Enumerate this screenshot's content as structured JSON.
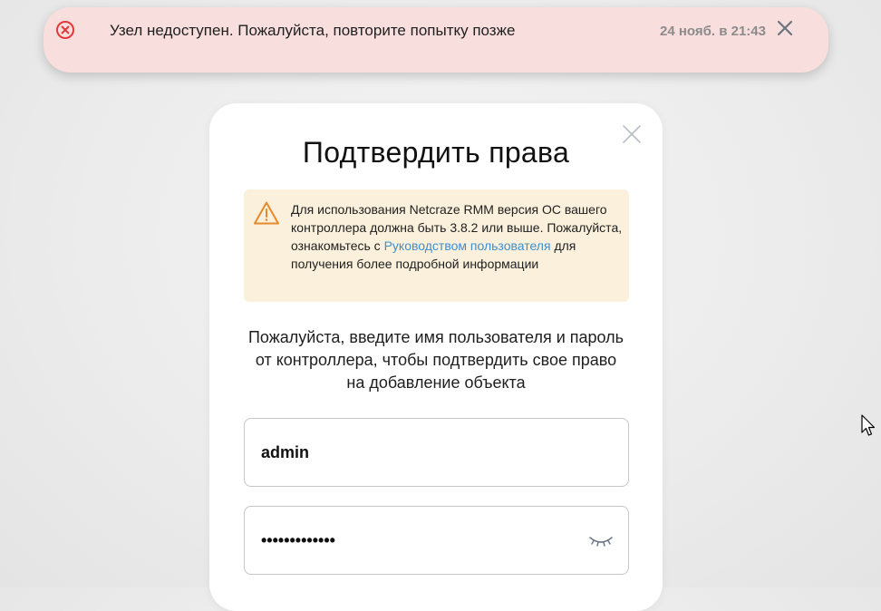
{
  "toast": {
    "message": "Узел недоступен. Пожалуйста, повторите попытку позже",
    "timestamp": "24 нояб. в 21:43",
    "icon": "error-circle-icon",
    "close_icon": "close-icon",
    "accent_color": "#e03a3a",
    "background_color": "#f9dede"
  },
  "modal": {
    "title": "Подтвердить права",
    "close_icon": "close-icon",
    "warning": {
      "icon": "warning-triangle-icon",
      "text_before": "Для использования Netcraze RMM версия ОС вашего контроллера должна быть 3.8.2 или выше. Пожалуйста, ознакомьтесь с ",
      "link_text": "Руководством пользователя",
      "text_after": " для получения более подробной информации",
      "background_color": "#faf0dc",
      "icon_color": "#e8892a",
      "link_color": "#3d8fd1"
    },
    "instructions": "Пожалуйста, введите имя пользователя и пароль от контроллера, чтобы подтвердить свое право на добавление объекта",
    "username": {
      "value": "admin"
    },
    "password": {
      "value": "•••••••••••••",
      "toggle_icon": "eye-closed-icon"
    }
  }
}
